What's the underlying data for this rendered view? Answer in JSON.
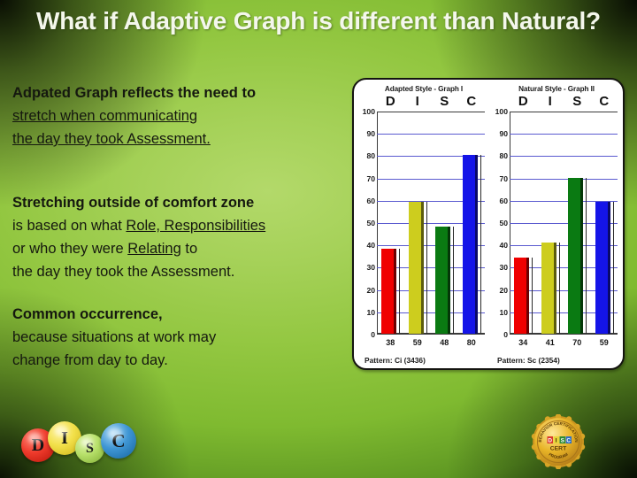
{
  "slide": {
    "title": "What if Adaptive Graph is different than Natural?",
    "background_colors": {
      "center_green": "#a5d158",
      "mid_green": "#7fba30",
      "corner_dark": "#0d1c05",
      "title_text": "#f4f7ec",
      "body_text": "#15180f"
    }
  },
  "body": {
    "paragraphs": [
      {
        "lines": [
          {
            "text": "Adpated Graph reflects the need to",
            "bold": true,
            "underline": false
          },
          {
            "text": "stretch when communicating",
            "bold": false,
            "underline": true
          },
          {
            "text": "the day they took Assessment.",
            "bold": false,
            "underline": true
          }
        ]
      },
      {
        "lines": [
          {
            "text": "Stretching outside of comfort zone",
            "bold": true,
            "underline": false
          },
          {
            "pre": "is based on what ",
            "underlined": "Role, Responsibilities",
            "post": ""
          },
          {
            "pre": "or who they were ",
            "underlined": "Relating",
            "post": " to"
          },
          {
            "text": "the day they took the Assessment.",
            "bold": false,
            "underline": false
          }
        ]
      },
      {
        "lines": [
          {
            "text": "Common occurrence,",
            "bold": true,
            "underline": false
          },
          {
            "text": "because situations at work may",
            "bold": false,
            "underline": false
          },
          {
            "text": "change from day to day.",
            "bold": false,
            "underline": false
          }
        ]
      }
    ]
  },
  "chart_data": [
    {
      "type": "bar",
      "title": "Adapted Style - Graph I",
      "categories": [
        "D",
        "I",
        "S",
        "C"
      ],
      "values": [
        38,
        59,
        48,
        80
      ],
      "data_labels": [
        "38",
        "59",
        "48",
        "80"
      ],
      "colors": [
        "#f00000",
        "#cdcd1e",
        "#0a7a12",
        "#1414e8"
      ],
      "ylim": [
        0,
        100
      ],
      "yticks": [
        0,
        10,
        20,
        30,
        40,
        50,
        60,
        70,
        80,
        90,
        100
      ],
      "ytick_labels": [
        "0",
        "10",
        "20",
        "30",
        "40",
        "50",
        "60",
        "70",
        "80",
        "90",
        "100"
      ],
      "xlabel": "",
      "ylabel": "",
      "grid": true,
      "legend": "none",
      "annotation": "Pattern: Ci (3436)"
    },
    {
      "type": "bar",
      "title": "Natural Style - Graph II",
      "categories": [
        "D",
        "I",
        "S",
        "C"
      ],
      "values": [
        34,
        41,
        70,
        59
      ],
      "data_labels": [
        "34",
        "41",
        "70",
        "59"
      ],
      "colors": [
        "#f00000",
        "#cdcd1e",
        "#0a7a12",
        "#1414e8"
      ],
      "ylim": [
        0,
        100
      ],
      "yticks": [
        0,
        10,
        20,
        30,
        40,
        50,
        60,
        70,
        80,
        90,
        100
      ],
      "ytick_labels": [
        "0",
        "10",
        "20",
        "30",
        "40",
        "50",
        "60",
        "70",
        "80",
        "90",
        "100"
      ],
      "xlabel": "",
      "ylabel": "",
      "grid": true,
      "legend": "none",
      "annotation": "Pattern: Sc (2354)"
    }
  ],
  "logo": {
    "name": "disc-spheres-logo",
    "letters": [
      "D",
      "I",
      "S",
      "C"
    ],
    "colors": [
      "#ef3b2c",
      "#f2e04a",
      "#b7e06a",
      "#3f96d4"
    ]
  },
  "seal": {
    "name": "disc-certification-seal",
    "center_text": "DISC",
    "center_subtext": "CERT",
    "ring_text_top": "BEHAVIOR CERTIFICATION",
    "ring_text_bottom": "PROGRAM",
    "color": "#e0a81e"
  }
}
